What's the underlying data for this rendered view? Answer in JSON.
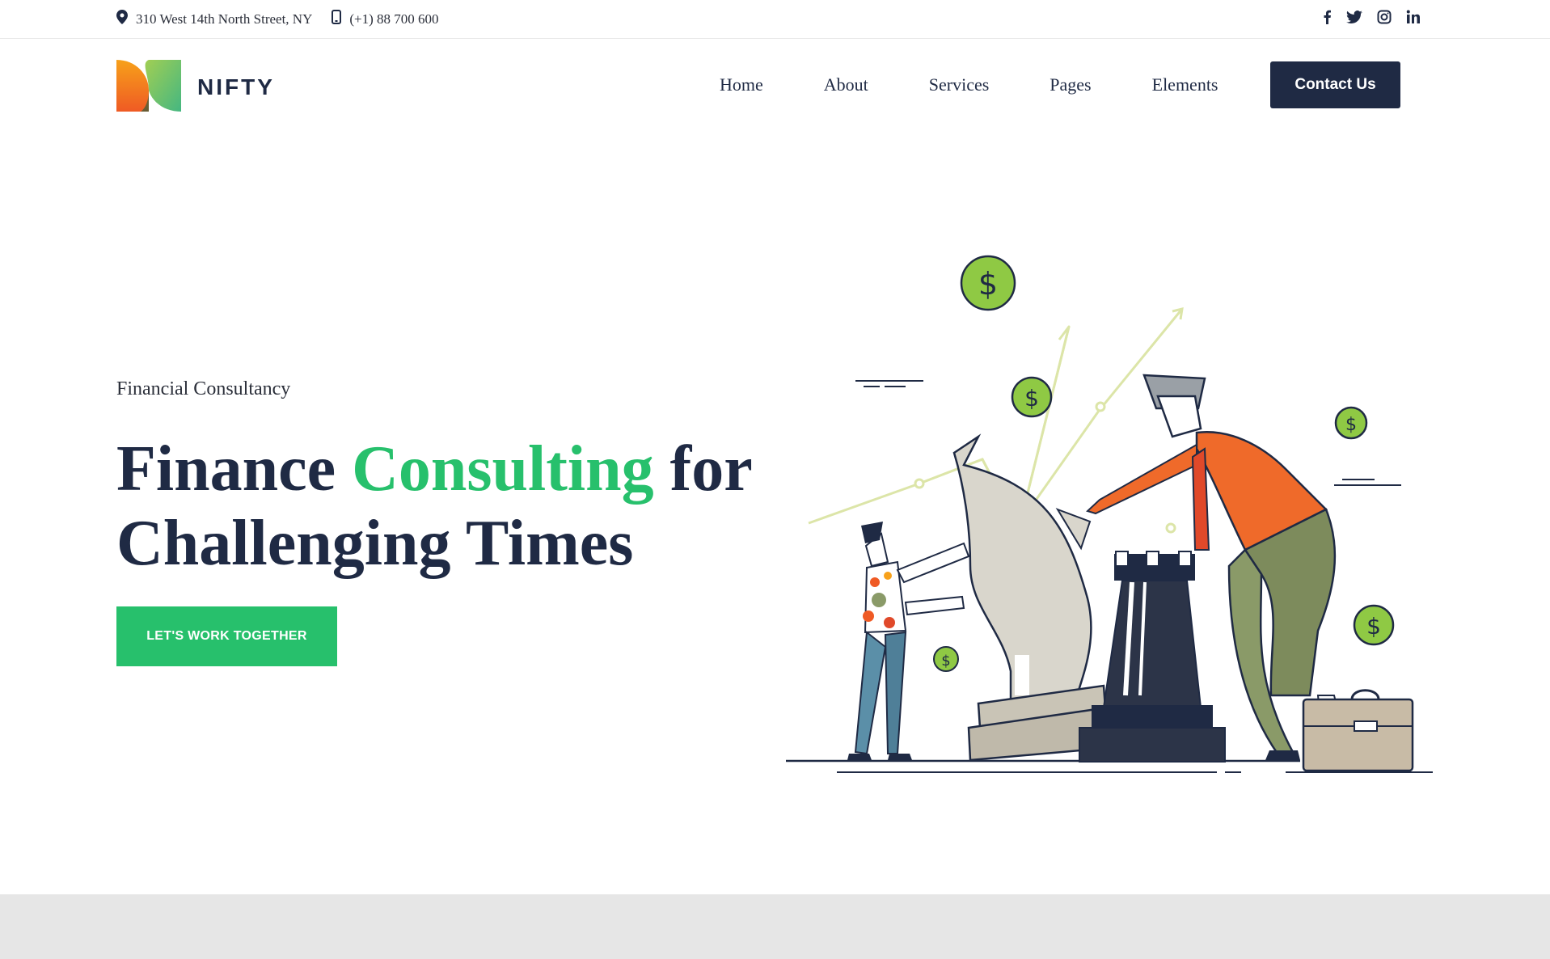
{
  "topbar": {
    "address": "310 West 14th North Street, NY",
    "phone": "(+1) 88 700 600",
    "social": [
      "facebook-icon",
      "twitter-icon",
      "instagram-icon",
      "linkedin-icon"
    ]
  },
  "header": {
    "logo_text": "NIFTY",
    "nav": [
      "Home",
      "About",
      "Services",
      "Pages",
      "Elements"
    ],
    "cta": "Contact Us"
  },
  "hero": {
    "eyebrow": "Financial Consultancy",
    "title_part1": "Finance ",
    "title_accent": "Consulting",
    "title_part2": " for Challenging Times",
    "button": "LET'S WORK TOGETHER"
  },
  "colors": {
    "navy": "#1f2a44",
    "accent_green": "#27c06c",
    "band_gray": "#e6e6e6"
  }
}
